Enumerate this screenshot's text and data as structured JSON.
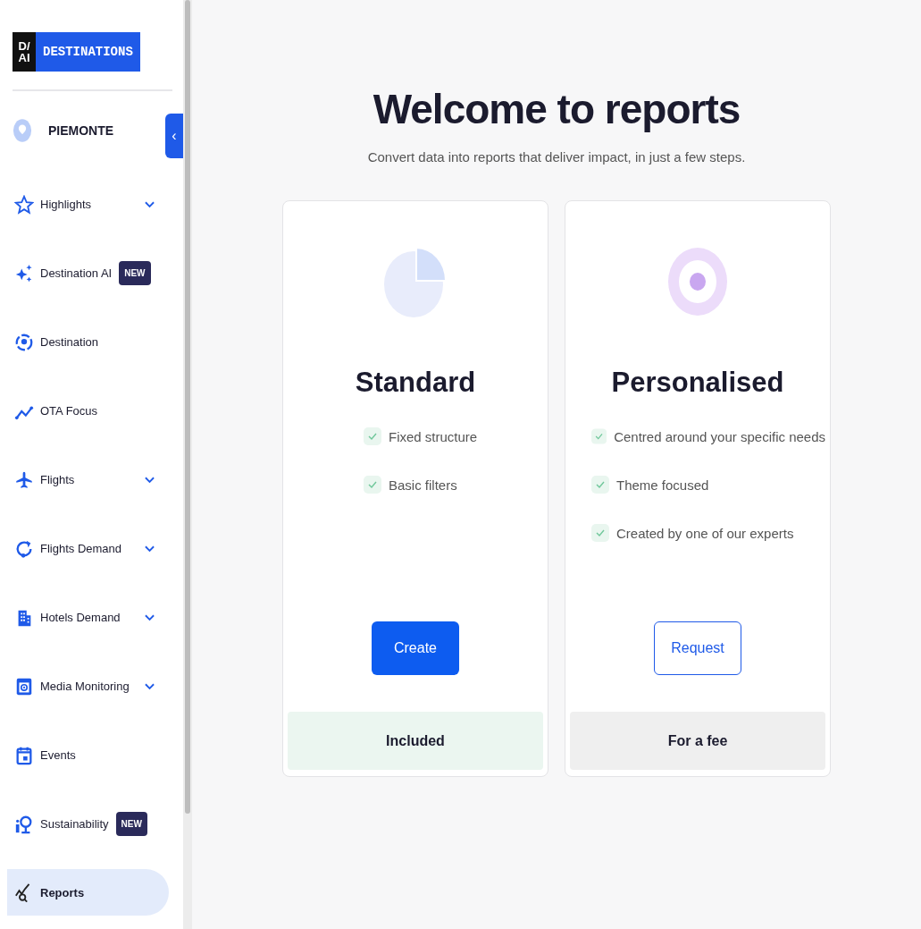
{
  "logo": {
    "mark_top": "D/",
    "mark_bottom": "AI",
    "text": "DESTINATIONS"
  },
  "destination": {
    "name": "PIEMONTE",
    "collapse_icon": "‹"
  },
  "nav": [
    {
      "label": "Highlights",
      "expandable": true,
      "selected": false
    },
    {
      "label": "Destination AI",
      "badge": "NEW",
      "expandable": false,
      "selected": false
    },
    {
      "label": "Destination",
      "expandable": false,
      "selected": false
    },
    {
      "label": "OTA Focus",
      "expandable": false,
      "selected": false
    },
    {
      "label": "Flights",
      "expandable": true,
      "selected": false
    },
    {
      "label": "Flights Demand",
      "expandable": true,
      "selected": false
    },
    {
      "label": "Hotels Demand",
      "expandable": true,
      "selected": false
    },
    {
      "label": "Media Monitoring",
      "expandable": true,
      "selected": false
    },
    {
      "label": "Events",
      "expandable": false,
      "selected": false
    },
    {
      "label": "Sustainability",
      "badge": "NEW",
      "expandable": false,
      "selected": false
    },
    {
      "label": "Reports",
      "expandable": false,
      "selected": true
    }
  ],
  "main": {
    "title": "Welcome to reports",
    "subtitle": "Convert data into reports that deliver impact, in just a few steps.",
    "cards": [
      {
        "kind": "standard",
        "title": "Standard",
        "features": [
          "Fixed structure",
          "Basic filters"
        ],
        "button": "Create",
        "footer": "Included"
      },
      {
        "kind": "personalised",
        "title": "Personalised",
        "features": [
          "Centred around your specific needs",
          "Theme focused",
          "Created by one of our experts"
        ],
        "button": "Request",
        "footer": "For a fee"
      }
    ]
  }
}
